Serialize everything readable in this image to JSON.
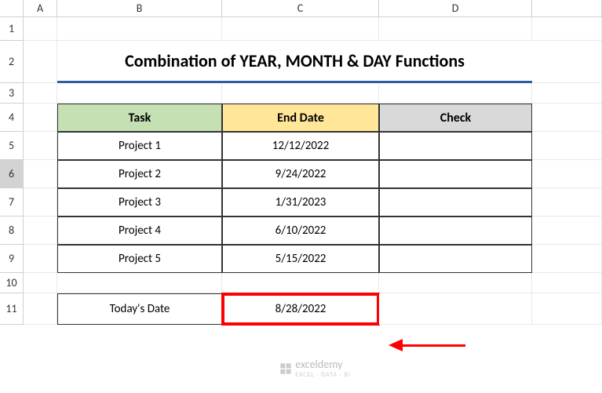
{
  "columns": [
    "A",
    "B",
    "C",
    "D"
  ],
  "rows": [
    "1",
    "2",
    "3",
    "4",
    "5",
    "6",
    "7",
    "8",
    "9",
    "10",
    "11"
  ],
  "selected_row": "6",
  "title": "Combination of YEAR, MONTH & DAY Functions",
  "headers": {
    "task": "Task",
    "end_date": "End Date",
    "check": "Check"
  },
  "table": [
    {
      "task": "Project 1",
      "end_date": "12/12/2022",
      "check": ""
    },
    {
      "task": "Project 2",
      "end_date": "9/24/2022",
      "check": ""
    },
    {
      "task": "Project 3",
      "end_date": "1/31/2023",
      "check": ""
    },
    {
      "task": "Project 4",
      "end_date": "6/10/2022",
      "check": ""
    },
    {
      "task": "Project 5",
      "end_date": "5/15/2022",
      "check": ""
    }
  ],
  "today": {
    "label": "Today's Date",
    "value": "8/28/2022"
  },
  "watermark": {
    "name": "exceldemy",
    "sub": "EXCEL · DATA · BI"
  }
}
